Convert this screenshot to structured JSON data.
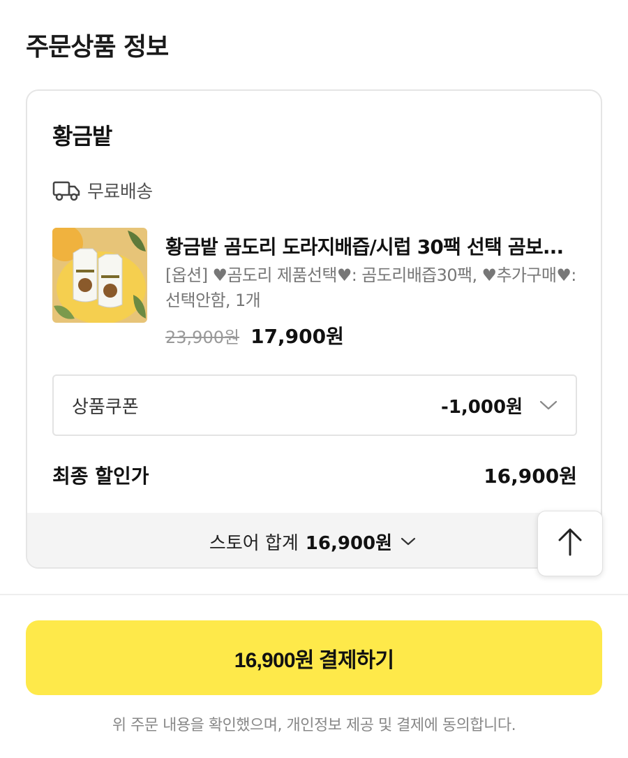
{
  "section": {
    "title": "주문상품 정보"
  },
  "store": {
    "name": "황금밭",
    "shipping_label": "무료배송"
  },
  "product": {
    "thumbnail_icon": "product-pouch-image",
    "name": "황금밭 곰도리 도라지배즙/시럽 30팩 선택 곰보...",
    "option": "[옵션] ♥곰도리 제품선택♥: 곰도리배즙30팩, ♥추가구매♥: 선택안함, 1개",
    "price_original": "23,900원",
    "price_sale": "17,900원"
  },
  "coupon": {
    "label": "상품쿠폰",
    "value": "-1,000원",
    "icon": "chevron-down-icon"
  },
  "final": {
    "label": "최종 할인가",
    "value": "16,900원"
  },
  "store_total": {
    "label": "스토어 합계",
    "value": "16,900원",
    "icon": "chevron-down-icon"
  },
  "scroll_top": {
    "icon": "arrow-up-icon"
  },
  "pay_button": {
    "label": "16,900원 결제하기"
  },
  "agreement": "위 주문 내용을 확인했으며, 개인정보 제공 및 결제에 동의합니다.",
  "colors": {
    "pay_button_bg": "#fee94a",
    "bar_bg": "#f4f4f4"
  }
}
